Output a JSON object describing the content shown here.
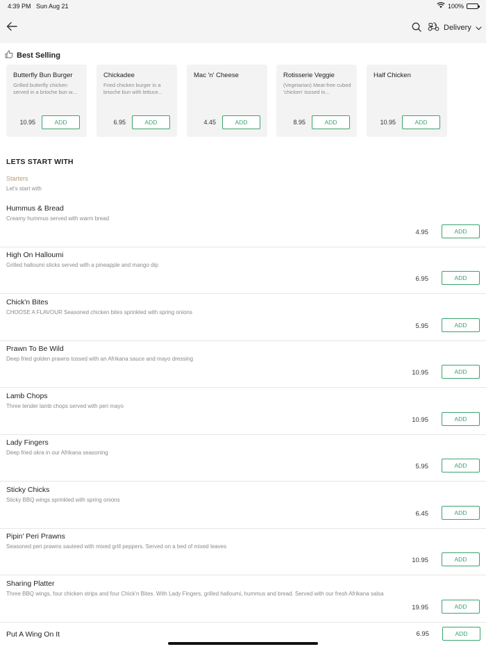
{
  "status_bar": {
    "time": "4:39 PM",
    "date": "Sun Aug 21",
    "battery": "100%"
  },
  "nav": {
    "delivery_label": "Delivery"
  },
  "best_selling": {
    "title": "Best Selling",
    "items": [
      {
        "name": "Butterfly Bun Burger",
        "desc": "Grilled butterfly chicken served in a brioche bun w...",
        "price": "10.95",
        "add_label": "ADD"
      },
      {
        "name": "Chickadee",
        "desc": "Fried chicken burger in a brioche bun with lettuce...",
        "price": "6.95",
        "add_label": "ADD"
      },
      {
        "name": "Mac 'n' Cheese",
        "desc": "",
        "price": "4.45",
        "add_label": "ADD"
      },
      {
        "name": "Rotisserie Veggie",
        "desc": "(Vegetarian) Meat-free cubed 'chicken' tossed in...",
        "price": "8.95",
        "add_label": "ADD"
      },
      {
        "name": "Half Chicken",
        "desc": "",
        "price": "10.95",
        "add_label": "ADD"
      }
    ]
  },
  "section": {
    "title": "LETS START WITH",
    "category_name": "Starters",
    "category_sub": "Let's start with"
  },
  "menu_items": [
    {
      "name": "Hummus & Bread",
      "desc": "Creamy hummus served with warm bread",
      "price": "4.95",
      "add_label": "ADD"
    },
    {
      "name": "High On Halloumi",
      "desc": "Grilled halloumi sticks served with a pineapple and mango dip",
      "price": "6.95",
      "add_label": "ADD"
    },
    {
      "name": "Chick'n Bites",
      "desc": "CHOOSE A FLAVOUR  Seasoned chicken bites sprinkled with spring onions",
      "price": "5.95",
      "add_label": "ADD"
    },
    {
      "name": "Prawn To Be Wild",
      "desc": "Deep fried golden prawns tossed with an Afrikana sauce and mayo dressing",
      "price": "10.95",
      "add_label": "ADD"
    },
    {
      "name": "Lamb Chops",
      "desc": "Three tender lamb chops served with peri mayo",
      "price": "10.95",
      "add_label": "ADD"
    },
    {
      "name": "Lady Fingers",
      "desc": "Deep fried okra in our Afrikana seasoning",
      "price": "5.95",
      "add_label": "ADD"
    },
    {
      "name": "Sticky Chicks",
      "desc": "Sticky BBQ wings sprinkled with spring onions",
      "price": "6.45",
      "add_label": "ADD"
    },
    {
      "name": "Pipin' Peri Prawns",
      "desc": "Seasoned peri prawns sauteed with mixed grill peppers. Served on a bed of mixed leaves",
      "price": "10.95",
      "add_label": "ADD"
    },
    {
      "name": "Sharing Platter",
      "desc": "Three BBQ wings, four chicken strips and four Chick'n Bites. With Lady Fingers, grilled halloumi, hummus and bread. Served with our fresh Afrikana salsa",
      "price": "19.95",
      "add_label": "ADD"
    },
    {
      "name": "Put A Wing On It",
      "desc": "",
      "price": "6.95",
      "add_label": "ADD"
    }
  ],
  "colors": {
    "accent": "#3aa36b",
    "category": "#b59a7a",
    "bar_bg": "#f4f4f4",
    "card_bg": "#f3f3f3"
  },
  "icons": [
    "wifi-icon",
    "battery-icon",
    "back-arrow-icon",
    "search-icon",
    "scooter-icon",
    "chevron-down-icon",
    "thumbs-up-icon"
  ]
}
